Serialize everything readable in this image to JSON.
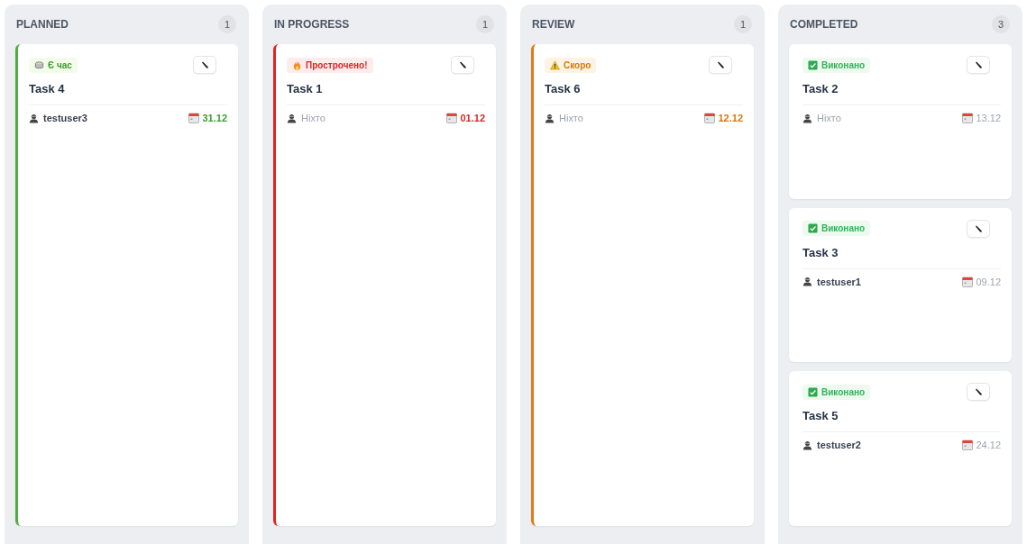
{
  "columns": [
    {
      "title": "PLANNED",
      "count": "1",
      "cards": [
        {
          "status": {
            "kind": "ok",
            "label": "Є час"
          },
          "title": "Task 4",
          "assignee": {
            "name": "testuser3",
            "unassigned": false
          },
          "due": "31.12"
        }
      ]
    },
    {
      "title": "IN PROGRESS",
      "count": "1",
      "cards": [
        {
          "status": {
            "kind": "overdue",
            "label": "Прострочено!"
          },
          "title": "Task 1",
          "assignee": {
            "name": "Ніхто",
            "unassigned": true
          },
          "due": "01.12"
        }
      ]
    },
    {
      "title": "REVIEW",
      "count": "1",
      "cards": [
        {
          "status": {
            "kind": "soon",
            "label": "Скоро"
          },
          "title": "Task 6",
          "assignee": {
            "name": "Ніхто",
            "unassigned": true
          },
          "due": "12.12"
        }
      ]
    },
    {
      "title": "COMPLETED",
      "count": "3",
      "cards": [
        {
          "status": {
            "kind": "done",
            "label": "Виконано"
          },
          "title": "Task 2",
          "assignee": {
            "name": "Ніхто",
            "unassigned": true
          },
          "due": "13.12"
        },
        {
          "status": {
            "kind": "done",
            "label": "Виконано"
          },
          "title": "Task 3",
          "assignee": {
            "name": "testuser1",
            "unassigned": false
          },
          "due": "09.12"
        },
        {
          "status": {
            "kind": "done",
            "label": "Виконано"
          },
          "title": "Task 5",
          "assignee": {
            "name": "testuser2",
            "unassigned": false
          },
          "due": "24.12"
        }
      ]
    }
  ]
}
